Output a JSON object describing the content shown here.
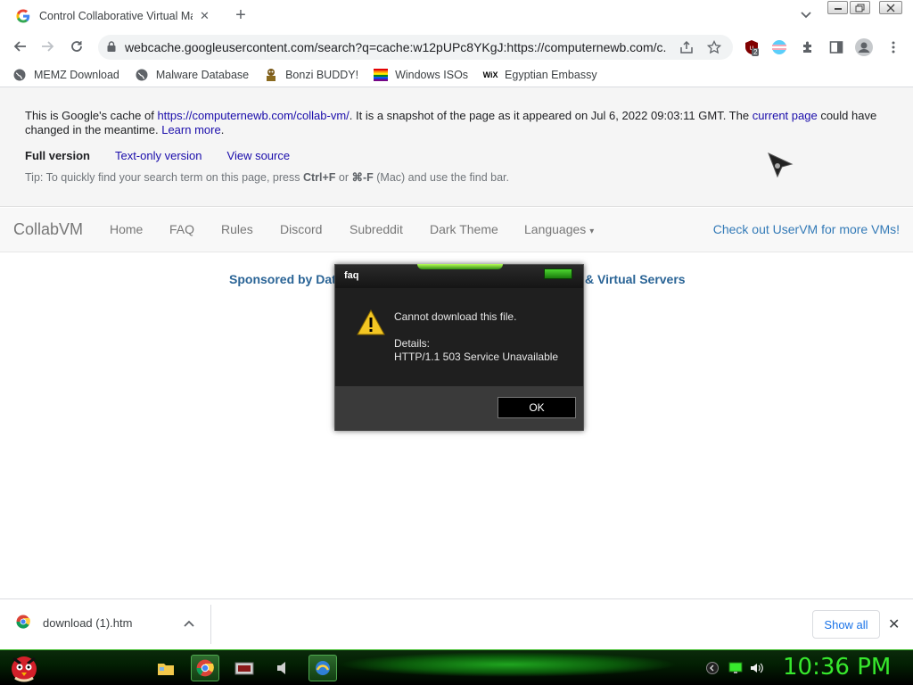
{
  "browser": {
    "tab_title": "Control Collaborative Virtual Ma",
    "tab_close": "✕",
    "new_tab": "+",
    "url": "webcache.googleusercontent.com/search?q=cache:w12pUPc8YKgJ:https://computernewb.com/c...",
    "ext_badge": "2"
  },
  "bookmarks": [
    {
      "label": "MEMZ Download",
      "icon": "globe-icon"
    },
    {
      "label": "Malware Database",
      "icon": "globe-icon"
    },
    {
      "label": "Bonzi BUDDY!",
      "icon": "bonzi-icon"
    },
    {
      "label": "Windows ISOs",
      "icon": "windows-flag-icon"
    },
    {
      "label": "Egyptian Embassy",
      "icon": "wix-icon"
    }
  ],
  "bookmark_wix_text": "WiX",
  "cache": {
    "line_prefix": "This is Google's cache of ",
    "cache_url": "https://computernewb.com/collab-vm/",
    "line_mid": ". It is a snapshot of the page as it appeared on Jul 6, 2022 09:03:11 GMT. The ",
    "current_page": "current page",
    "line_suffix": " could have changed in the meantime. ",
    "learn_more": "Learn more",
    "period": ".",
    "full_version": "Full version",
    "text_only": "Text-only version",
    "view_source": "View source",
    "tip_a": "Tip: To quickly find your search term on this page, press ",
    "tip_b": "Ctrl+F",
    "tip_c": " or ",
    "tip_d": "⌘-F",
    "tip_e": " (Mac) and use the find bar."
  },
  "site": {
    "brand": "CollabVM",
    "nav": [
      "Home",
      "FAQ",
      "Rules",
      "Discord",
      "Subreddit",
      "Dark Theme",
      "Languages"
    ],
    "languages_caret": "▾",
    "uservm": "Check out UserVM for more VMs!",
    "sponsor_left": "Sponsored by Dat",
    "sponsor_right": "& Virtual Servers"
  },
  "dialog": {
    "title": "faq",
    "message": "Cannot download this file.",
    "details_label": "Details:",
    "details": "HTTP/1.1 503 Service Unavailable",
    "ok": "OK"
  },
  "downloads": {
    "filename": "download (1).htm",
    "show_all": "Show all",
    "close": "✕"
  },
  "taskbar": {
    "clock": "10:36 PM"
  },
  "colors": {
    "accent_green": "#37e82d",
    "link": "#1a0dab",
    "bootstrap_link": "#337ab7"
  }
}
